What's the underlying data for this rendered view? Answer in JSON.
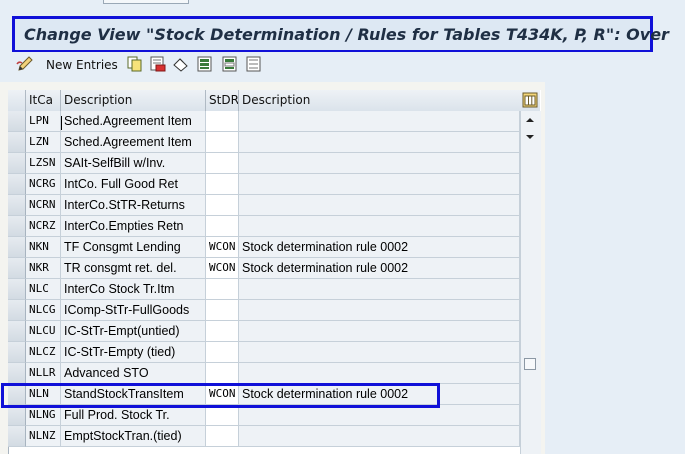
{
  "window": {
    "title": "Change View \"Stock Determination / Rules for Tables T434K, P, R\": Over"
  },
  "toolbar": {
    "new_entries_label": "New Entries",
    "icons": [
      "edit-icon",
      "copy-icon",
      "delete-icon",
      "undo-icon",
      "select-all-icon",
      "select-block-icon",
      "deselect-all-icon"
    ]
  },
  "table": {
    "headers": [
      "ItCa",
      "Description",
      "StDR",
      "Description"
    ],
    "rows": [
      {
        "itca": "LPN",
        "desc": "Sched.Agreement Item",
        "stdr": "",
        "rule": ""
      },
      {
        "itca": "LZN",
        "desc": "Sched.Agreement Item",
        "stdr": "",
        "rule": ""
      },
      {
        "itca": "LZSN",
        "desc": "SAIt-SelfBill w/Inv.",
        "stdr": "",
        "rule": ""
      },
      {
        "itca": "NCRG",
        "desc": "IntCo. Full Good Ret",
        "stdr": "",
        "rule": ""
      },
      {
        "itca": "NCRN",
        "desc": "InterCo.StTR-Returns",
        "stdr": "",
        "rule": ""
      },
      {
        "itca": "NCRZ",
        "desc": "InterCo.Empties Retn",
        "stdr": "",
        "rule": ""
      },
      {
        "itca": "NKN",
        "desc": "TF Consgmt Lending",
        "stdr": "WCON",
        "rule": "Stock determination rule 0002"
      },
      {
        "itca": "NKR",
        "desc": "TR consgmt ret. del.",
        "stdr": "WCON",
        "rule": "Stock determination rule 0002"
      },
      {
        "itca": "NLC",
        "desc": "InterCo Stock Tr.Itm",
        "stdr": "",
        "rule": ""
      },
      {
        "itca": "NLCG",
        "desc": "IComp-StTr-FullGoods",
        "stdr": "",
        "rule": ""
      },
      {
        "itca": "NLCU",
        "desc": "IC-StTr-Empt(untied)",
        "stdr": "",
        "rule": ""
      },
      {
        "itca": "NLCZ",
        "desc": "IC-StTr-Empty (tied)",
        "stdr": "",
        "rule": ""
      },
      {
        "itca": "NLLR",
        "desc": "Advanced STO",
        "stdr": "",
        "rule": ""
      },
      {
        "itca": "NLN",
        "desc": "StandStockTransItem",
        "stdr": "WCON",
        "rule": "Stock determination rule 0002"
      },
      {
        "itca": "NLNG",
        "desc": "Full Prod. Stock Tr.",
        "stdr": "",
        "rule": ""
      },
      {
        "itca": "NLNZ",
        "desc": "EmptStockTran.(tied)",
        "stdr": "",
        "rule": ""
      }
    ],
    "highlighted_row": "NLN"
  },
  "colors": {
    "highlight_border": "#1010d8",
    "background": "#e6eef6",
    "title_text": "#1f2f44"
  }
}
